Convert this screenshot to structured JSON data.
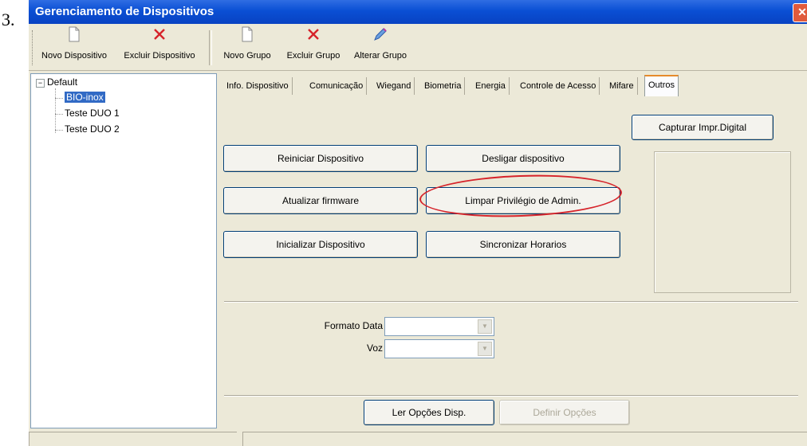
{
  "step_number": "3.",
  "window": {
    "title": "Gerenciamento de Dispositivos",
    "close_glyph": "✕"
  },
  "toolbar": {
    "new_device": "Novo Dispositivo",
    "delete_device": "Excluir Dispositivo",
    "new_group": "Novo Grupo",
    "delete_group": "Excluir Grupo",
    "edit_group": "Alterar Grupo"
  },
  "tree": {
    "root": "Default",
    "expander": "−",
    "items": [
      "BIO-inox",
      "Teste DUO 1",
      "Teste DUO 2"
    ]
  },
  "tabs": [
    "Info. Dispositivo",
    "Comunicação",
    "Wiegand",
    "Biometria",
    "Energia",
    "Controle de Acesso",
    "Mifare",
    "Outros"
  ],
  "active_tab": "Outros",
  "panel": {
    "capture_fingerprint": "Capturar Impr.Digital",
    "restart_device": "Reiniciar Dispositivo",
    "shutdown_device": "Desligar dispositivo",
    "update_firmware": "Atualizar firmware",
    "clear_admin": "Limpar Privilégio de Admin.",
    "init_device": "Inicializar Dispositivo",
    "sync_time": "Sincronizar Horarios",
    "date_format_label": "Formato Data",
    "date_format_value": "",
    "voice_label": "Voz",
    "voice_value": "",
    "read_options": "Ler Opções Disp.",
    "set_options": "Definir Opções"
  },
  "colors": {
    "titlebar": "#0a4fd4",
    "selection": "#316ac5",
    "annotation": "#d6232a"
  }
}
